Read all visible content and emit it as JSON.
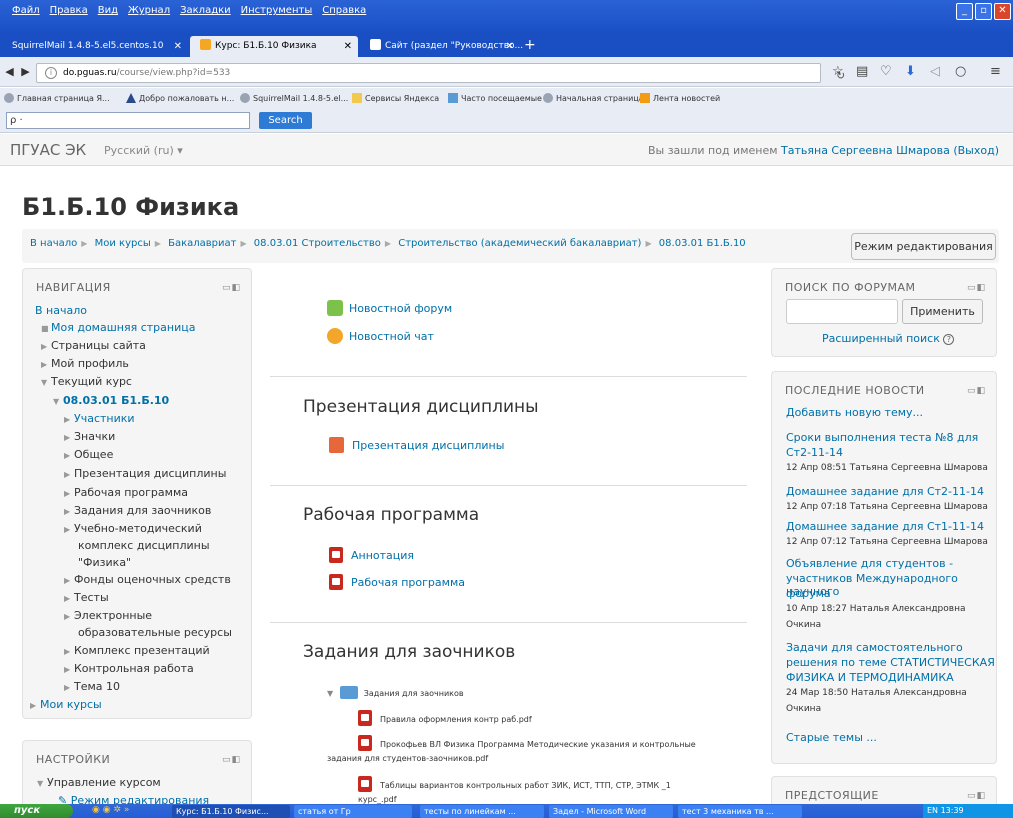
{
  "browser": {
    "menus": [
      "Файл",
      "Правка",
      "Вид",
      "Журнал",
      "Закладки",
      "Инструменты",
      "Справка"
    ],
    "tabs": [
      {
        "label": "SquirrelMail 1.4.8-5.el5.centos.10",
        "active": false
      },
      {
        "label": "Курс: Б1.Б.10 Физика",
        "active": true
      },
      {
        "label": "Сайт (раздел \"Руководство...",
        "active": false
      }
    ],
    "new_tab": "+",
    "url_host": "do.pguas.ru",
    "url_path": "/course/view.php?id=533",
    "url_prefix": "",
    "bookmarks": [
      "Главная страница Я...",
      "Добро пожаловать н...",
      "SquirrelMail 1.4.8-5.el...",
      "Сервисы Яндекса",
      "Часто посещаемые",
      "Начальная страница",
      "Лента новостей"
    ],
    "search_placeholder": "ρ ·",
    "search_button": "Search"
  },
  "site": {
    "brand": "ПГУАС ЭК",
    "language": "Русский (ru) ▾",
    "login_prefix": "Вы зашли под именем",
    "user_name": "Татьяна Сергеевна Шмарова",
    "logout": "(Выход)"
  },
  "course": {
    "title": "Б1.Б.10 Физика",
    "breadcrumb": [
      "В начало",
      "Мои курсы",
      "Бакалавриат",
      "08.03.01 Строительство",
      "Строительство (академический бакалавриат)",
      "08.03.01 Б1.Б.10"
    ],
    "edit_button": "Режим редактирования"
  },
  "nav_block": {
    "title": "НАВИГАЦИЯ",
    "home": "В начало",
    "items": [
      {
        "label": "Моя домашняя страница"
      },
      {
        "label": "Страницы сайта"
      },
      {
        "label": "Мой профиль"
      },
      {
        "label": "Текущий курс"
      },
      {
        "label": "08.03.01 Б1.Б.10"
      },
      {
        "label": "Участники"
      },
      {
        "label": "Значки"
      },
      {
        "label": "Общее"
      },
      {
        "label": "Презентация дисциплины"
      },
      {
        "label": "Рабочая программа"
      },
      {
        "label": "Задания для заочников"
      },
      {
        "label": "Учебно-методический"
      },
      {
        "label": "комплекс дисциплины"
      },
      {
        "label": "\"Физика\""
      },
      {
        "label": "Фонды оценочных средств"
      },
      {
        "label": "Тесты"
      },
      {
        "label": "Электронные"
      },
      {
        "label": "образовательные ресурсы"
      },
      {
        "label": "Комплекс презентаций"
      },
      {
        "label": "Контрольная работа"
      },
      {
        "label": "Тема 10"
      },
      {
        "label": "Мои курсы"
      }
    ]
  },
  "settings_block": {
    "title": "НАСТРОЙКИ",
    "item1": "Управление курсом",
    "item2": "Режим редактирования"
  },
  "main": {
    "general": {
      "forum": "Новостной форум",
      "chat": "Новостной чат"
    },
    "sections": [
      {
        "title": "Презентация дисциплины",
        "activities": [
          "Презентация дисциплины"
        ]
      },
      {
        "title": "Рабочая программа",
        "activities": [
          "Аннотация",
          "Рабочая программа"
        ]
      },
      {
        "title": "Задания для заочников",
        "activities": []
      }
    ],
    "folder": {
      "name": "Задания для заочников",
      "files": [
        "Правила оформления контр раб.pdf",
        "Прокофьев ВЛ Физика Программа Методические указания и контрольные",
        "задания для студентов-заочников.pdf",
        "Таблицы вариантов контрольных работ ЗИК, ИСТ, ТТП, СТР, ЭТМК _1",
        "курс_.pdf"
      ]
    }
  },
  "forum_search": {
    "title": "ПОИСК ПО ФОРУМАМ",
    "input_value": "",
    "apply": "Применить",
    "advanced": "Расширенный поиск"
  },
  "latest_news": {
    "title": "ПОСЛЕДНИЕ НОВОСТИ",
    "add": "Добавить новую тему...",
    "items": [
      {
        "l1": "Сроки выполнения теста №8 для",
        "l2": "Ст2-11-14",
        "meta": "12 Апр 08:51  Татьяна Сергеевна Шмарова"
      },
      {
        "l1": "Домашнее задание для Ст2-11-14",
        "meta": "12 Апр 07:18  Татьяна Сергеевна Шмарова"
      },
      {
        "l1": "Домашнее задание для Ст1-11-14",
        "meta": "12 Апр 07:12  Татьяна Сергеевна Шмарова"
      },
      {
        "l1": "Объявление для студентов -",
        "l2": "участников Международного научного",
        "l3": "форума",
        "meta": "10 Апр 18:27  Наталья Александровна",
        "meta2": "Очкина"
      },
      {
        "l1": "Задачи для самостоятельного",
        "l2": "решения по теме СТАТИСТИЧЕСКАЯ",
        "l3": "ФИЗИКА И ТЕРМОДИНАМИКА",
        "meta": "24 Мар 18:50  Наталья Александровна",
        "meta2": "Очкина"
      }
    ],
    "older": "Старые темы ..."
  },
  "upcoming": {
    "title": "ПРЕДСТОЯЩИЕ"
  },
  "taskbar": {
    "start": "пуск",
    "tasks": [
      "Курс: Б1.Б.10 Физис...",
      "статья от Гр",
      "тесты по линейкам ...",
      "Задел - Microsoft Word",
      "тест 3 механика тв ..."
    ],
    "tray": "EN  13:39"
  }
}
